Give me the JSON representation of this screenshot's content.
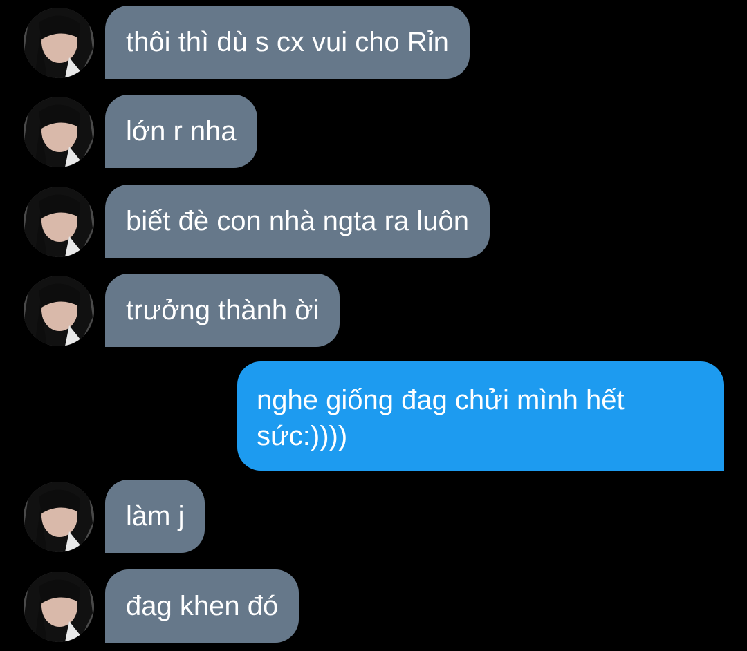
{
  "messages": [
    {
      "side": "in",
      "text": "thôi thì dù s cx vui cho Rỉn"
    },
    {
      "side": "in",
      "text": "lớn r nha"
    },
    {
      "side": "in",
      "text": "biết đè con nhà ngta ra luôn"
    },
    {
      "side": "in",
      "text": "trưởng thành ời"
    },
    {
      "side": "out",
      "text": "nghe giống đag chửi mình hết sức:))))"
    },
    {
      "side": "in",
      "text": "làm j"
    },
    {
      "side": "in",
      "text": "đag khen đó"
    }
  ],
  "colors": {
    "background": "#000000",
    "incoming_bubble": "#66788a",
    "outgoing_bubble": "#1d9bf0",
    "text": "#ffffff"
  },
  "icons": {
    "avatar": "avatar-photo"
  }
}
